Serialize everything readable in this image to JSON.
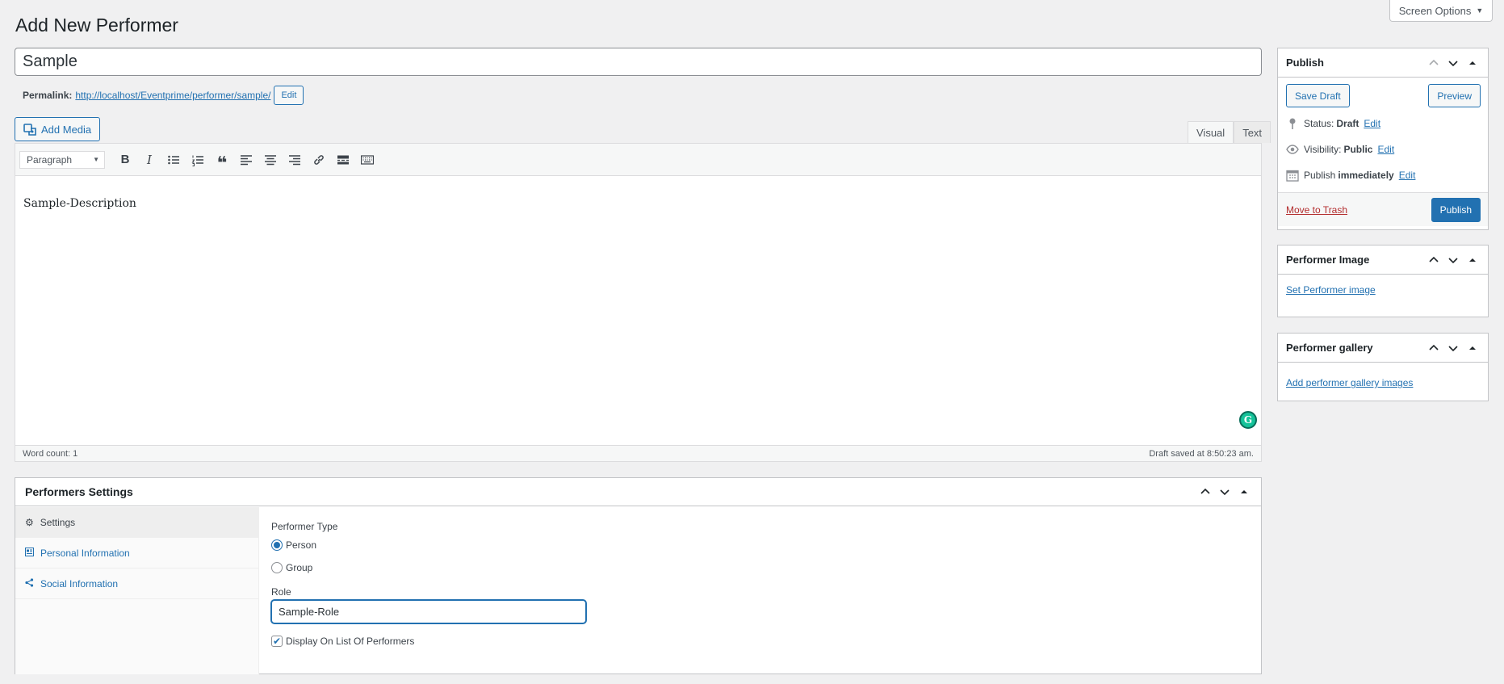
{
  "screen_options": {
    "label": "Screen Options"
  },
  "page": {
    "title": "Add New Performer"
  },
  "post_title": {
    "value": "Sample"
  },
  "permalink": {
    "label": "Permalink:",
    "url": "http://localhost/Eventprime/performer/sample/",
    "edit_label": "Edit"
  },
  "media": {
    "add_label": "Add Media"
  },
  "editor": {
    "tabs": [
      "Visual",
      "Text"
    ],
    "format_select": "Paragraph",
    "content": "Sample-Description",
    "word_count": "Word count: 1",
    "draft_saved": "Draft saved at 8:50:23 am."
  },
  "performers_settings": {
    "title": "Performers Settings",
    "nav": [
      {
        "label": "Settings",
        "icon": "gear-icon"
      },
      {
        "label": "Personal Information",
        "icon": "id-card-icon"
      },
      {
        "label": "Social Information",
        "icon": "share-icon"
      }
    ],
    "performer_type_label": "Performer Type",
    "type_options": [
      "Person",
      "Group"
    ],
    "selected_type": "Person",
    "role_label": "Role",
    "role_value": "Sample-Role",
    "display_on_list_label": "Display On List Of Performers",
    "display_on_list_checked": true
  },
  "publish": {
    "title": "Publish",
    "save_draft": "Save Draft",
    "preview": "Preview",
    "status_label": "Status:",
    "status_value": "Draft",
    "visibility_label": "Visibility:",
    "visibility_value": "Public",
    "publish_label": "Publish",
    "publish_value": "immediately",
    "edit_label": "Edit",
    "trash_label": "Move to Trash",
    "publish_button": "Publish"
  },
  "performer_image": {
    "title": "Performer Image",
    "link": "Set Performer image"
  },
  "performer_gallery": {
    "title": "Performer gallery",
    "link": "Add performer gallery images"
  },
  "colors": {
    "accent": "#2271b1",
    "danger": "#b32d2e",
    "grammarly": "#15c39a"
  }
}
